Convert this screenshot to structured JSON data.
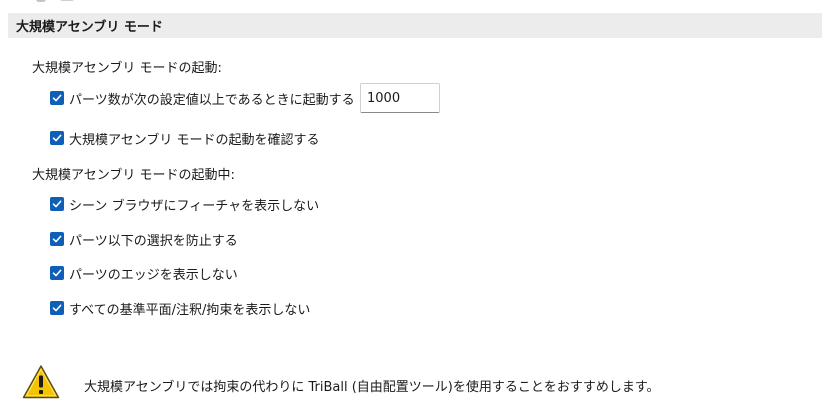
{
  "section": {
    "title": "大規模アセンブリ モード"
  },
  "on_start": {
    "label": "大規模アセンブリ モードの起動:",
    "threshold": {
      "label": "パーツ数が次の設定値以上であるときに起動する",
      "checked": true,
      "value": "1000"
    },
    "confirm": {
      "label": "大規模アセンブリ モードの起動を確認する",
      "checked": true
    }
  },
  "during": {
    "label": "大規模アセンブリ モードの起動中:",
    "options": [
      {
        "label": "シーン ブラウザにフィーチャを表示しない",
        "checked": true
      },
      {
        "label": "パーツ以下の選択を防止する",
        "checked": true
      },
      {
        "label": "パーツのエッジを表示しない",
        "checked": true
      },
      {
        "label": "すべての基準平面/注釈/拘束を表示しない",
        "checked": true
      }
    ]
  },
  "warning": {
    "icon": "warning-icon",
    "text": "大規模アセンブリでは拘束の代わりに TriBall (自由配置ツール)を使用することをおすすめします。"
  },
  "colors": {
    "checkbox": "#0e5fb8",
    "header_bg": "#ececec",
    "warning_yellow": "#f3c400"
  }
}
